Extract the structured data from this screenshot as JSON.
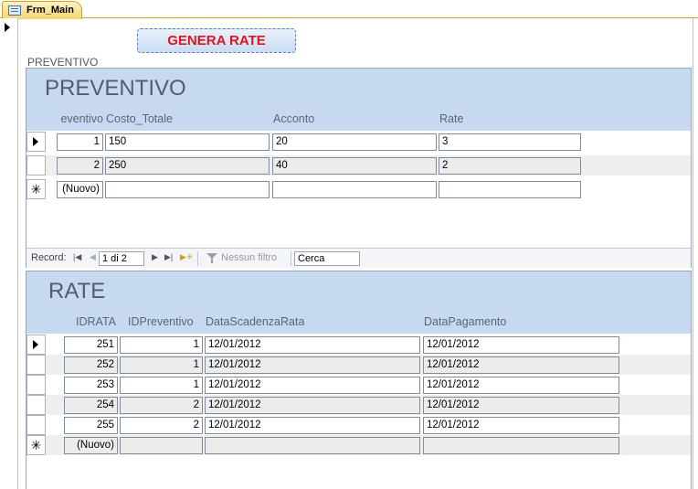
{
  "tab": {
    "label": "Frm_Main"
  },
  "buttons": {
    "genera_rate": "GENERA RATE"
  },
  "subform_label": "PREVENTIVO",
  "preventivo": {
    "title": "PREVENTIVO",
    "columns": [
      "eventivo",
      "Costo_Totale",
      "Acconto",
      "Rate"
    ],
    "rows": [
      {
        "id": "1",
        "costo_totale": "150",
        "acconto": "20",
        "rate": "3"
      },
      {
        "id": "2",
        "costo_totale": "250",
        "acconto": "40",
        "rate": "2"
      }
    ],
    "new_record": "(Nuovo)",
    "nav": {
      "record_label": "Record:",
      "position": "1 di 2",
      "filter": "Nessun filtro",
      "search": "Cerca"
    }
  },
  "rate": {
    "title": "RATE",
    "columns": [
      "IDRATA",
      "IDPreventivo",
      "DataScadenzaRata",
      "DataPagamento"
    ],
    "rows": [
      {
        "idrata": "251",
        "idpreventivo": "1",
        "scadenza": "12/01/2012",
        "pagamento": "12/01/2012"
      },
      {
        "idrata": "252",
        "idpreventivo": "1",
        "scadenza": "12/01/2012",
        "pagamento": "12/01/2012"
      },
      {
        "idrata": "253",
        "idpreventivo": "1",
        "scadenza": "12/01/2012",
        "pagamento": "12/01/2012"
      },
      {
        "idrata": "254",
        "idpreventivo": "2",
        "scadenza": "12/01/2012",
        "pagamento": "12/01/2012"
      },
      {
        "idrata": "255",
        "idpreventivo": "2",
        "scadenza": "12/01/2012",
        "pagamento": "12/01/2012"
      }
    ],
    "new_record": "(Nuovo)"
  }
}
